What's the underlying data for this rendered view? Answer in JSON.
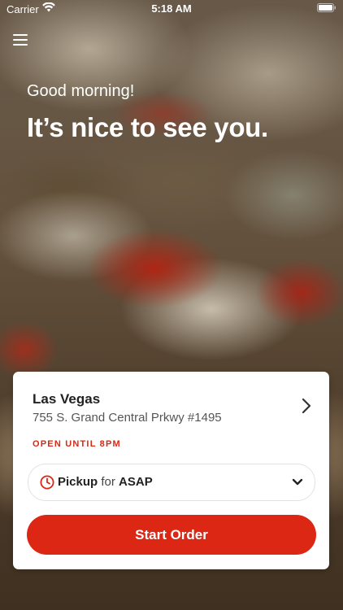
{
  "status_bar": {
    "carrier": "Carrier",
    "time": "5:18 AM",
    "icons": [
      "wifi-icon",
      "battery-icon"
    ]
  },
  "header": {
    "menu_icon": "menu-icon",
    "greeting": "Good morning!",
    "headline": "It’s nice to see you."
  },
  "store": {
    "name": "Las Vegas",
    "address": "755 S. Grand Central Prkwy #1495",
    "hours": "OPEN UNTIL 8PM",
    "chevron_icon": "chevron-right-icon"
  },
  "order_mode": {
    "icon": "clock-icon",
    "mode": "Pickup",
    "connector": "for",
    "time": "ASAP",
    "dropdown_icon": "chevron-down-icon"
  },
  "actions": {
    "start_order_label": "Start Order"
  },
  "colors": {
    "accent": "#db2714",
    "hours_text": "#d42a16",
    "card_background": "#ffffff"
  }
}
